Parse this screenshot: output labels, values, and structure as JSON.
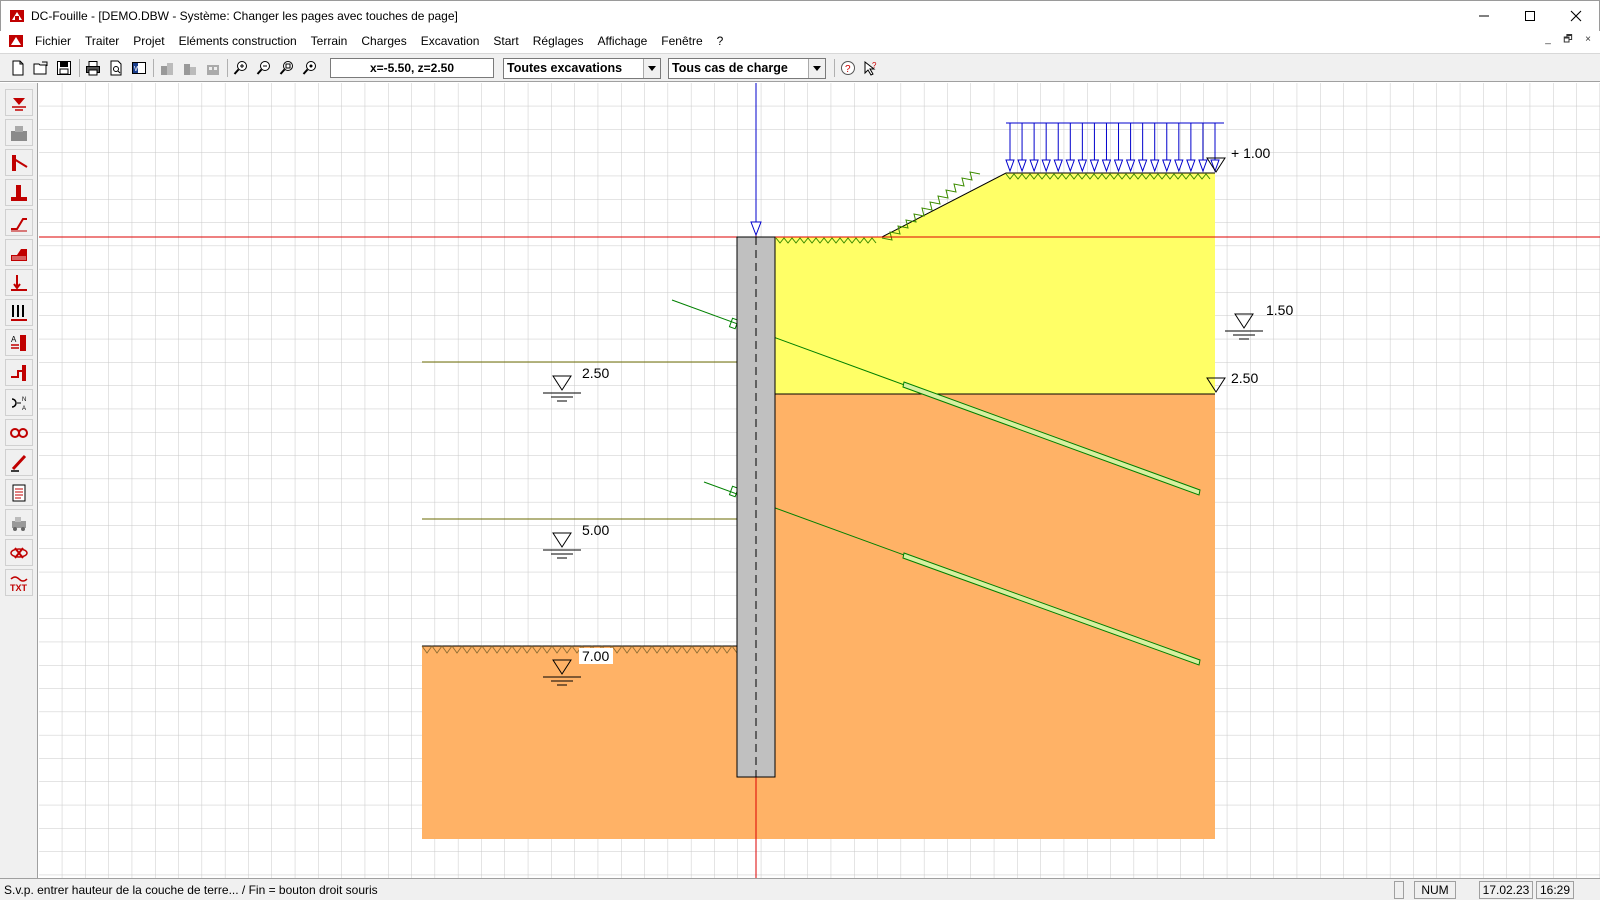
{
  "window": {
    "title": "DC-Fouille - [DEMO.DBW - Système: Changer les pages avec touches de page]",
    "icon": "app-logo-icon",
    "controls": [
      "minimize-icon",
      "maximize-icon",
      "close-icon"
    ]
  },
  "menu": {
    "items": [
      "Fichier",
      "Traiter",
      "Projet",
      "Eléments construction",
      "Terrain",
      "Charges",
      "Excavation",
      "Start",
      "Réglages",
      "Affichage",
      "Fenêtre",
      "?"
    ],
    "mdi_controls": [
      "_",
      "🗗",
      "×"
    ]
  },
  "toolbar": {
    "buttons": [
      "new-file-icon",
      "open-file-icon",
      "save-icon",
      "print-icon",
      "print-preview-icon",
      "export-word-icon",
      "building-icon-1",
      "building-icon-2",
      "building-icon-3",
      "zoom-in-icon",
      "zoom-out-icon",
      "zoom-window-icon",
      "zoom-all-icon",
      "help-icon",
      "context-help-icon"
    ],
    "coordinates": "x=-5.50, z=2.50",
    "excavation_select": "Toutes excavations",
    "loadcase_select": "Tous cas de charge"
  },
  "sidebar": {
    "tools": [
      "water-level-tool-icon",
      "soil-layer-tool-icon",
      "anchor-tool-icon",
      "wall-tool-icon",
      "slope-tool-icon",
      "terrain-tool-icon",
      "point-load-tool-icon",
      "distributed-load-tool-icon",
      "soil-param-tool-icon",
      "excavation-tool-icon",
      "numbering-tool-icon",
      "view-tool-icon",
      "edit-tool-icon",
      "report-tool-icon",
      "machine-tool-icon",
      "delete-tool-icon",
      "text-tool-icon"
    ]
  },
  "drawing": {
    "levels": {
      "surcharge_level": "+ 1.00",
      "water_right": "1.50",
      "layer_boundary": "2.50",
      "excavation_1": "2.50",
      "excavation_2": "5.00",
      "excavation_final": "7.00"
    },
    "colors": {
      "upper_soil": "#ffff66",
      "lower_soil": "#ffb266",
      "wall": "#c0c0c0",
      "anchor": "#008000",
      "load": "#0000cc",
      "axis": "#dd0000",
      "grid": "#c8c8c8",
      "terrain_hatch": "#3c8c00"
    }
  },
  "status": {
    "message": "S.v.p. entrer hauteur de la couche de terre... / Fin = bouton droit souris",
    "num": "NUM",
    "date": "17.02.23",
    "time": "16:29"
  }
}
